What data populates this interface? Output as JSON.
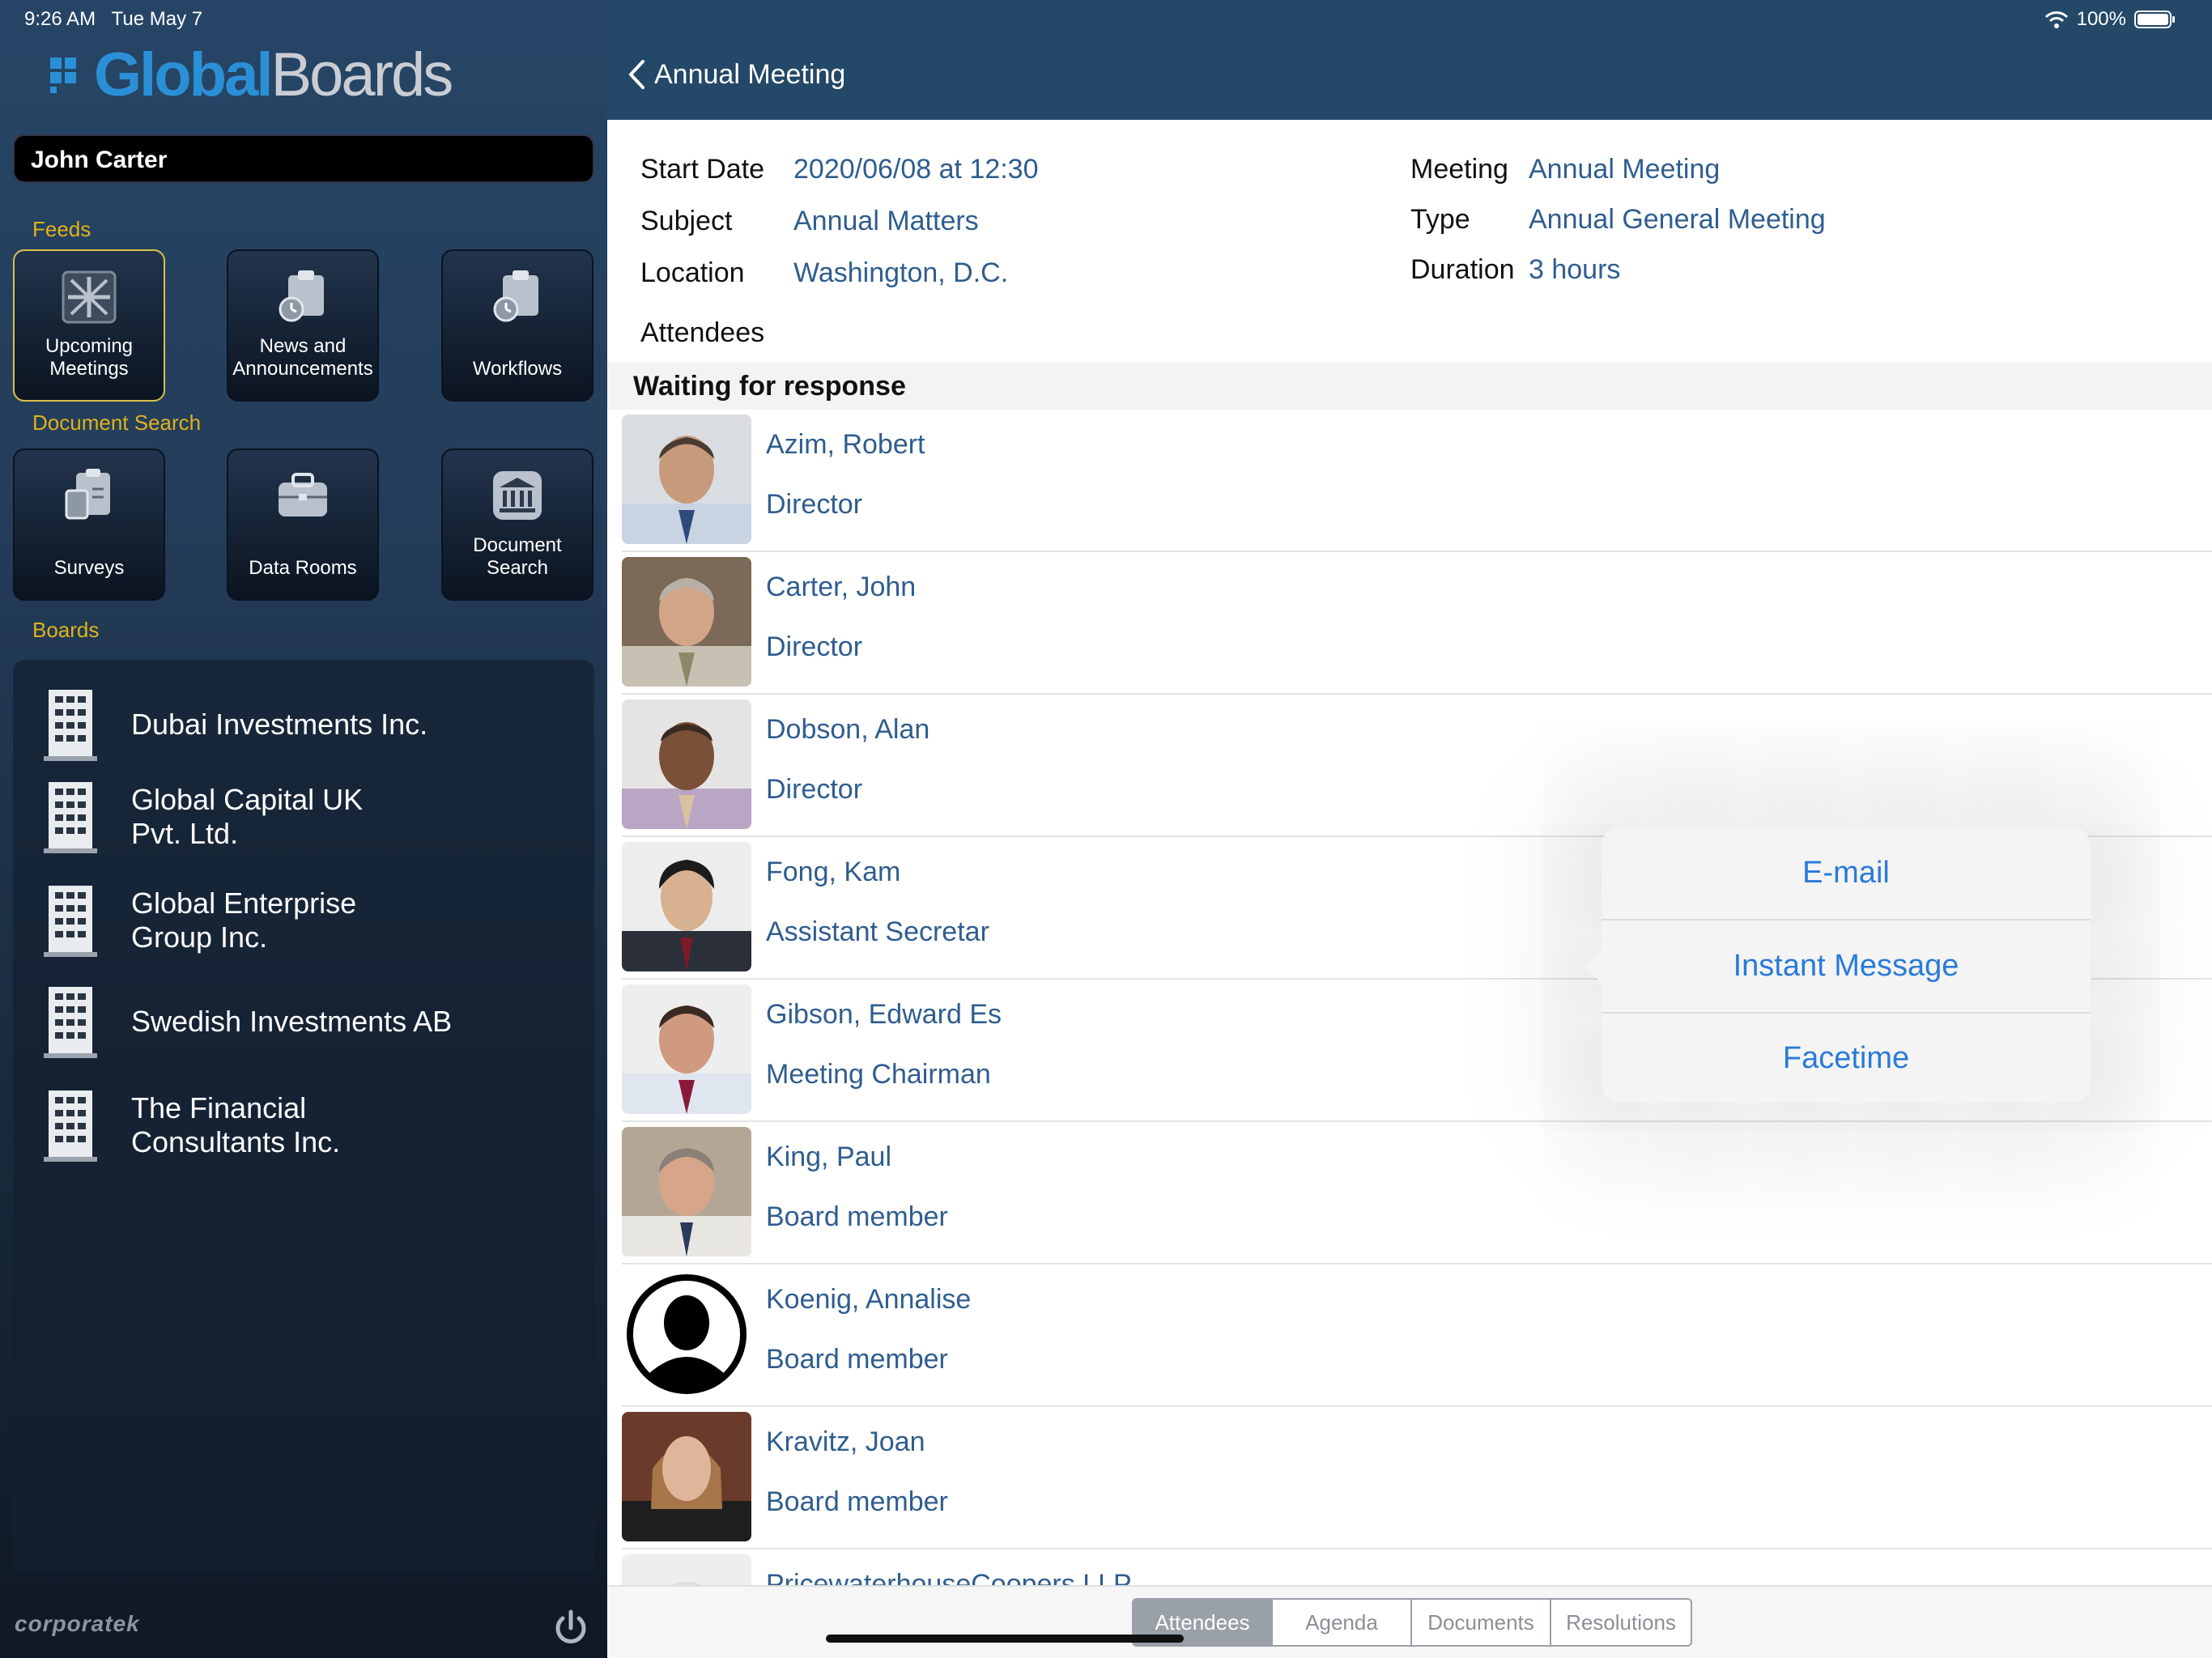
{
  "statusbar": {
    "time": "9:26 AM",
    "date": "Tue May 7",
    "battery": "100%"
  },
  "logo": {
    "part1": "Global",
    "part2": "Boards"
  },
  "user": {
    "name": "John Carter"
  },
  "sections": {
    "feeds": "Feeds",
    "document_search": "Document Search",
    "boards": "Boards"
  },
  "feeds": [
    {
      "label": "Upcoming\nMeetings",
      "icon": "calendar-icon"
    },
    {
      "label": "News and\nAnnouncements",
      "icon": "news-clipboard-icon"
    },
    {
      "label": "Workflows",
      "icon": "workflow-clipboard-icon"
    }
  ],
  "doc_tiles": [
    {
      "label": "Surveys",
      "icon": "survey-clipboard-icon"
    },
    {
      "label": "Data Rooms",
      "icon": "briefcase-icon"
    },
    {
      "label": "Document\nSearch",
      "icon": "bank-icon"
    }
  ],
  "boards": [
    {
      "name": "Dubai Investments Inc."
    },
    {
      "name": "Global Capital UK\nPvt. Ltd."
    },
    {
      "name": "Global Enterprise\nGroup Inc."
    },
    {
      "name": "Swedish Investments AB"
    },
    {
      "name": "The Financial\nConsultants Inc."
    }
  ],
  "footer": {
    "brand": "corporatek"
  },
  "nav": {
    "back_label": "Annual Meeting"
  },
  "details": {
    "start_date_label": "Start Date",
    "start_date": "2020/06/08 at 12:30",
    "subject_label": "Subject",
    "subject": "Annual Matters",
    "location_label": "Location",
    "location": "Washington, D.C.",
    "meeting_label": "Meeting",
    "meeting": "Annual Meeting",
    "type_label": "Type",
    "type": "Annual General Meeting",
    "duration_label": "Duration",
    "duration": "3 hours",
    "attendees_label": "Attendees"
  },
  "section_header": "Waiting for response",
  "attendees": [
    {
      "name": "Azim, Robert",
      "role": "Director"
    },
    {
      "name": "Carter, John",
      "role": "Director"
    },
    {
      "name": "Dobson, Alan",
      "role": "Director"
    },
    {
      "name": "Fong, Kam",
      "role": "Assistant Secretar"
    },
    {
      "name": "Gibson, Edward Es",
      "role": "Meeting Chairman"
    },
    {
      "name": "King, Paul",
      "role": "Board member"
    },
    {
      "name": "Koenig, Annalise",
      "role": "Board member"
    },
    {
      "name": "Kravitz, Joan",
      "role": "Board member"
    },
    {
      "name": "PricewaterhouseCoopers LLP",
      "role": ""
    }
  ],
  "popover": {
    "items": [
      "E-mail",
      "Instant Message",
      "Facetime"
    ]
  },
  "tabs": [
    {
      "label": "Attendees",
      "active": true
    },
    {
      "label": "Agenda",
      "active": false
    },
    {
      "label": "Documents",
      "active": false
    },
    {
      "label": "Resolutions",
      "active": false
    }
  ],
  "colors": {
    "nav": "#244868",
    "accent": "#2f5d8f",
    "feeds_label": "#e0b21b",
    "link": "#2a7bd8"
  }
}
